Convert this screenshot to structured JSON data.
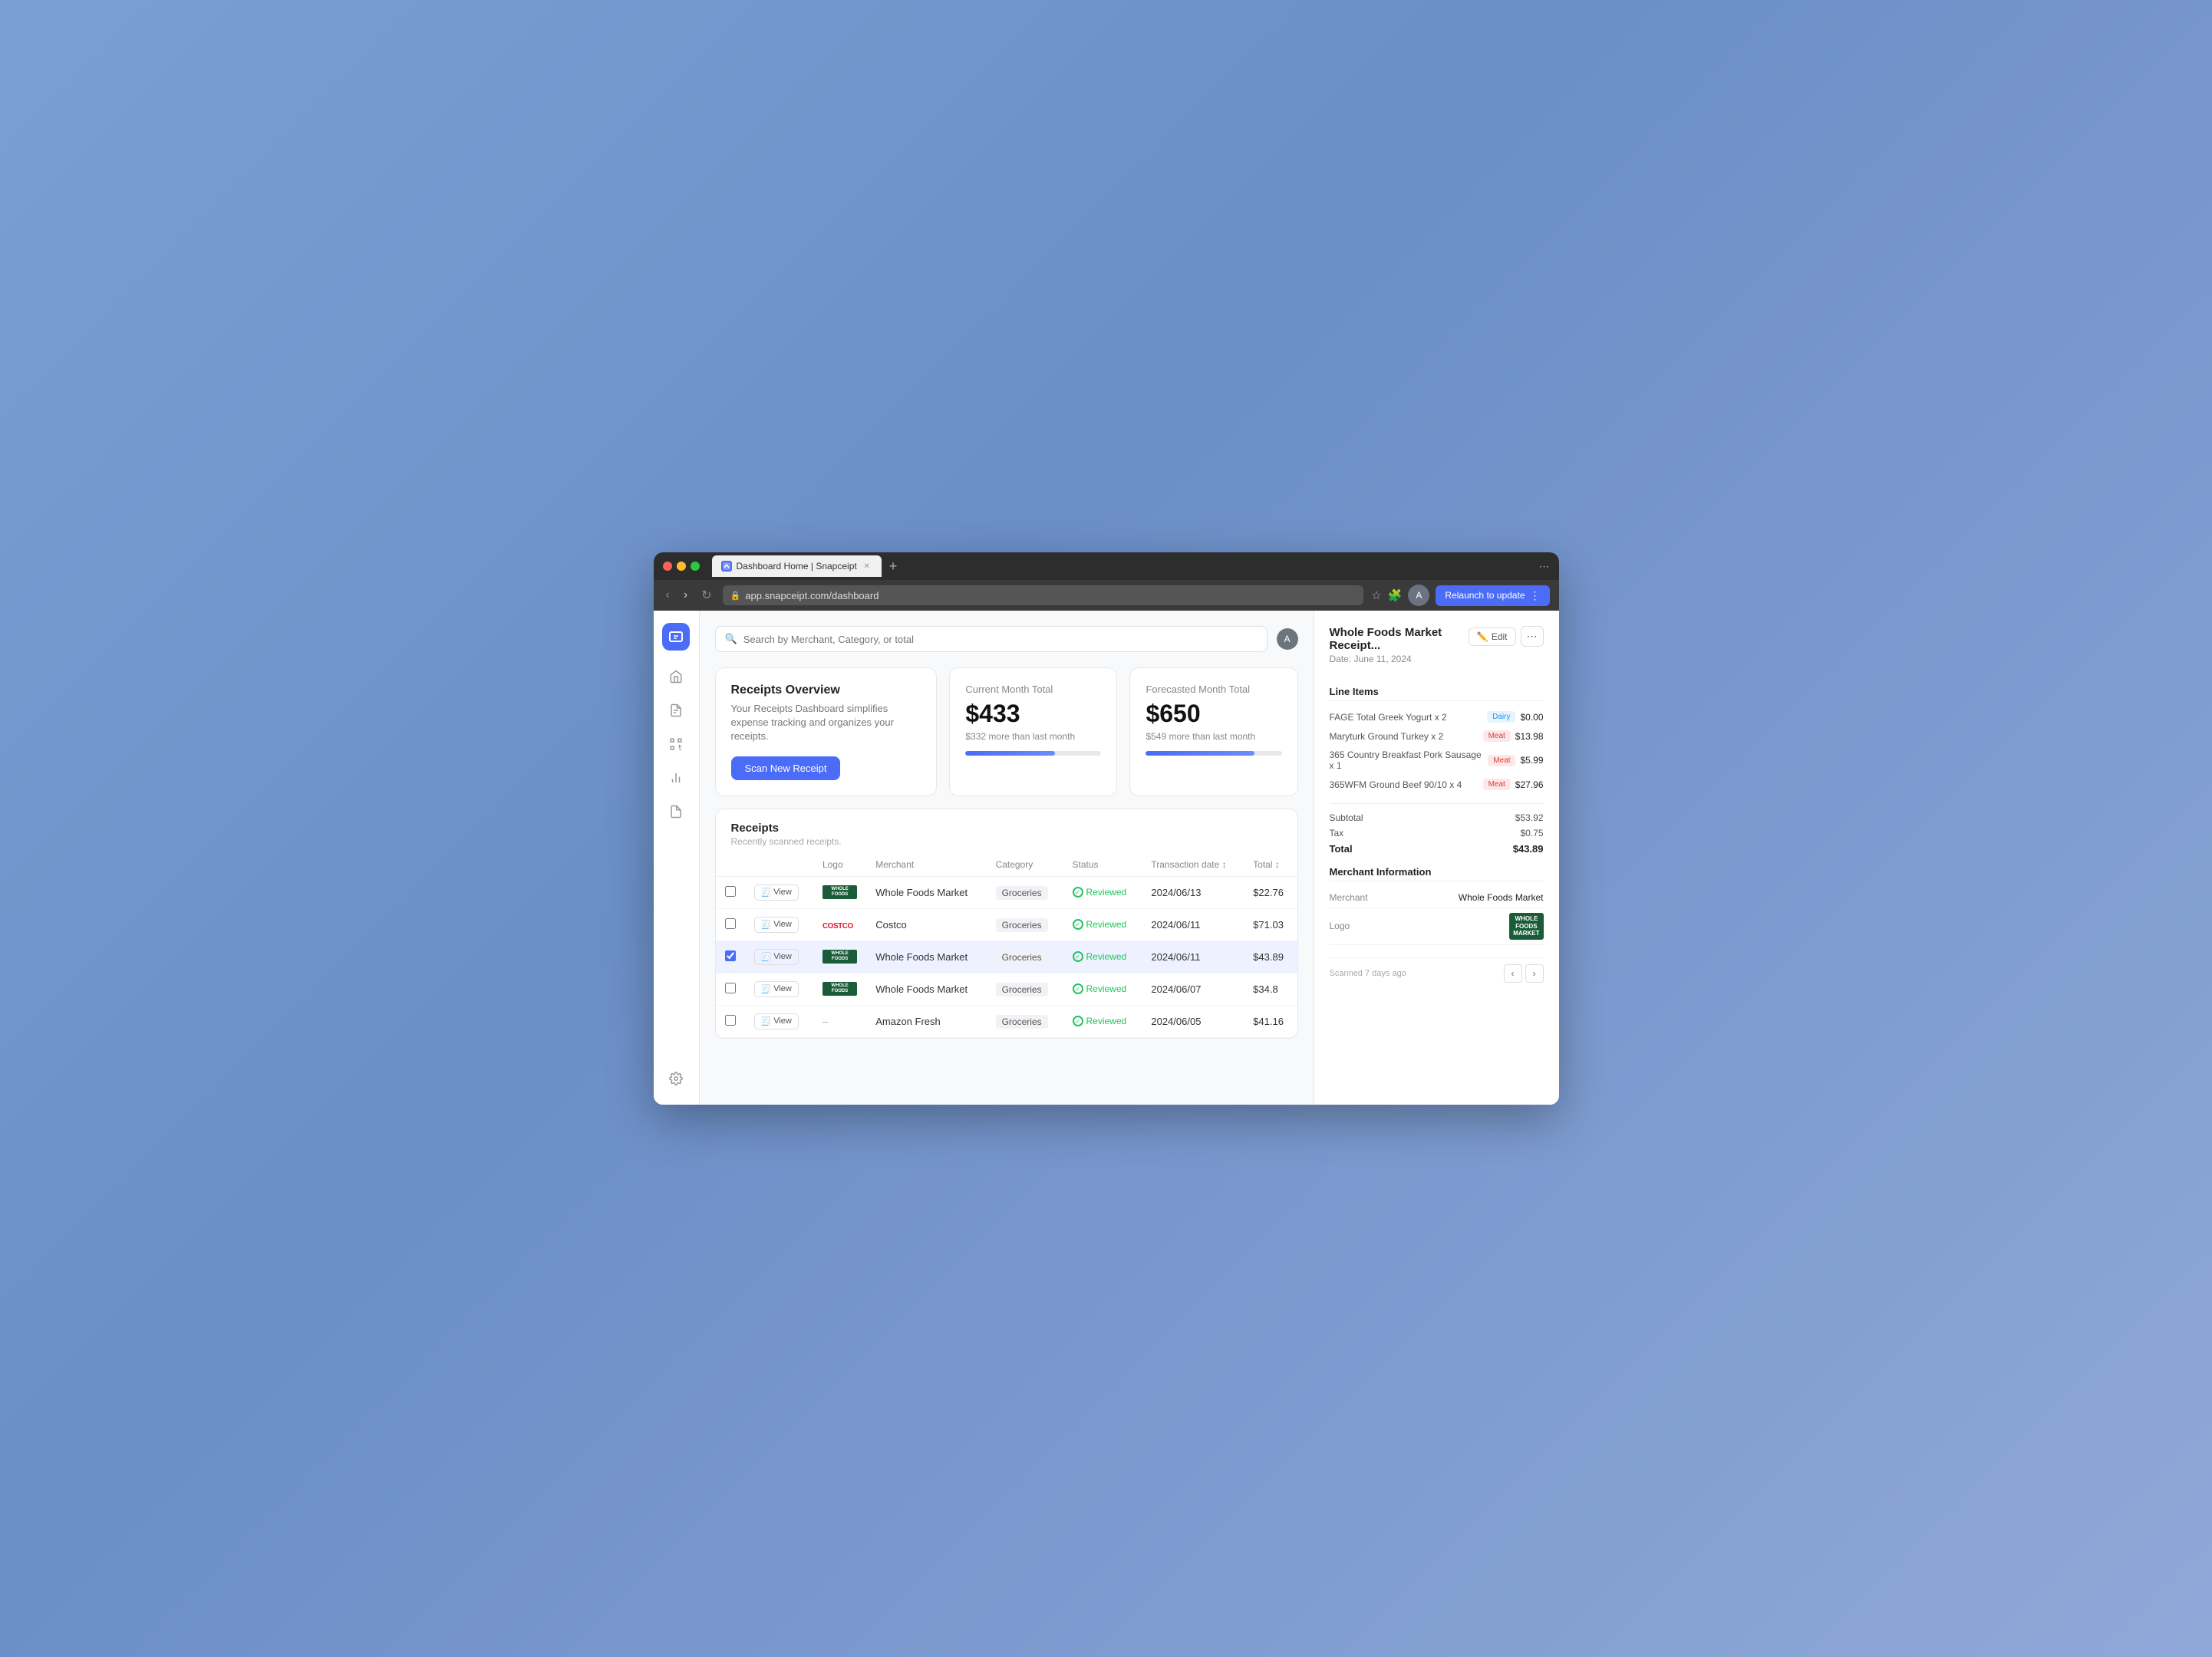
{
  "browser": {
    "tab_label": "Dashboard Home | Snapceipt",
    "tab_favicon": "S",
    "address": "app.snapceipt.com/dashboard",
    "relaunch_label": "Relaunch to update"
  },
  "search": {
    "placeholder": "Search by Merchant, Category, or total"
  },
  "overview_card": {
    "title": "Receipts Overview",
    "description": "Your Receipts Dashboard simplifies expense tracking and organizes your receipts.",
    "button_label": "Scan New Receipt"
  },
  "current_month_card": {
    "label": "Current Month Total",
    "value": "$433",
    "sub": "$332 more than last month",
    "progress": 66
  },
  "forecasted_month_card": {
    "label": "Forecasted Month Total",
    "value": "$650",
    "sub": "$549 more than last month",
    "progress": 80
  },
  "receipts_section": {
    "title": "Receipts",
    "subtitle": "Recently scanned receipts.",
    "columns": [
      "Logo",
      "Merchant",
      "Category",
      "Status",
      "Transaction date",
      "Total"
    ],
    "rows": [
      {
        "id": 1,
        "logo_type": "wf",
        "merchant": "Whole Foods Market",
        "category": "Groceries",
        "status": "Reviewed",
        "date": "2024/06/13",
        "total": "$22.76",
        "selected": false
      },
      {
        "id": 2,
        "logo_type": "costco",
        "merchant": "Costco",
        "category": "Groceries",
        "status": "Reviewed",
        "date": "2024/06/11",
        "total": "$71.03",
        "selected": false
      },
      {
        "id": 3,
        "logo_type": "wf",
        "merchant": "Whole Foods Market",
        "category": "Groceries",
        "status": "Reviewed",
        "date": "2024/06/11",
        "total": "$43.89",
        "selected": true
      },
      {
        "id": 4,
        "logo_type": "wf",
        "merchant": "Whole Foods Market",
        "category": "Groceries",
        "status": "Reviewed",
        "date": "2024/06/07",
        "total": "$34.8",
        "selected": false
      },
      {
        "id": 5,
        "logo_type": "none",
        "merchant": "Amazon Fresh",
        "category": "Groceries",
        "status": "Reviewed",
        "date": "2024/06/05",
        "total": "$41.16",
        "selected": false
      }
    ]
  },
  "receipt_panel": {
    "title": "Whole Foods Market Receipt...",
    "date": "Date: June 11, 2024",
    "edit_label": "Edit",
    "line_items_section": "Line Items",
    "line_items": [
      {
        "name": "FAGE Total Greek Yogurt x 2",
        "tag": "Dairy",
        "tag_type": "dairy",
        "price": "$0.00"
      },
      {
        "name": "Maryturk Ground Turkey x 2",
        "tag": "Meat",
        "tag_type": "meat",
        "price": "$13.98"
      },
      {
        "name": "365 Country Breakfast Pork Sausage x 1",
        "tag": "Meat",
        "tag_type": "meat",
        "price": "$5.99"
      },
      {
        "name": "365WFM Ground Beef 90/10 x 4",
        "tag": "Meat",
        "tag_type": "meat",
        "price": "$27.96"
      }
    ],
    "subtotal_label": "Subtotal",
    "subtotal_value": "$53.92",
    "tax_label": "Tax",
    "tax_value": "$0.75",
    "total_label": "Total",
    "total_value": "$43.89",
    "merchant_section": "Merchant Information",
    "merchant_label": "Merchant",
    "merchant_value": "Whole Foods Market",
    "logo_label": "Logo",
    "scanned_text": "Scanned 7 days ago"
  },
  "sidebar": {
    "icons": [
      "🧾",
      "🏠",
      "📋",
      "⬜",
      "📈",
      "📄"
    ],
    "settings_icon": "⚙️"
  }
}
